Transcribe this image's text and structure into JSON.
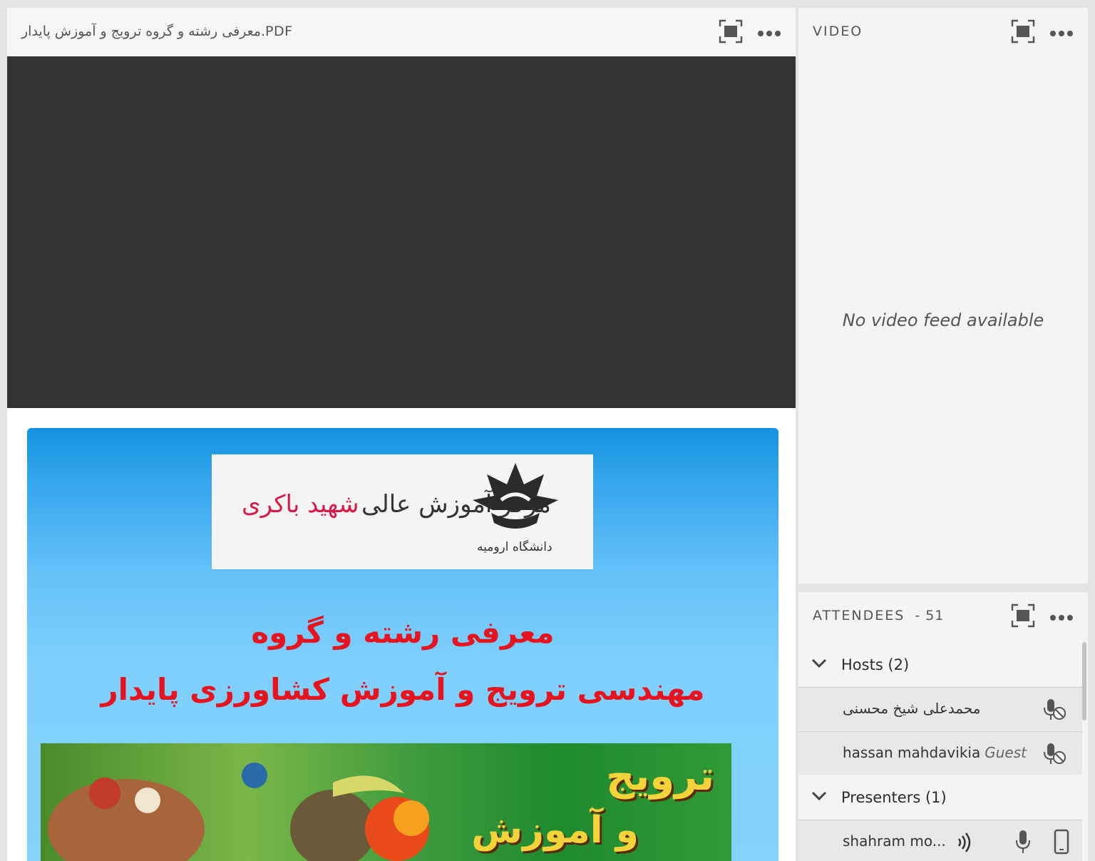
{
  "share_pod": {
    "title": "معرفی رشته و گروه ترویج و آموزش پایدار.PDF",
    "fullscreen_icon": "fullscreen-icon",
    "more_icon": "more-options-icon",
    "slide": {
      "logo_org_line_1": "مرکز آموزش عالی",
      "logo_org_line_2": "شهید باکری",
      "logo_sub": "دانشگاه ارومیه",
      "heading_line_1": "معرفی رشته و گروه",
      "heading_line_2": "مهندسی ترویج و آموزش کشاورزی پایدار",
      "banner_line_1": "ترویج",
      "banner_line_2": "و آموزش"
    },
    "colors": {
      "stage": "#323232",
      "slide_text": "#e8131f"
    }
  },
  "video_pod": {
    "label": "VIDEO",
    "empty_message": "No video feed available"
  },
  "attendees_pod": {
    "label": "ATTENDEES",
    "count": "- 51",
    "groups": [
      {
        "label": "Hosts (2)",
        "members": [
          {
            "name": "محمدعلی شیخ محسنی",
            "role": ""
          },
          {
            "name": "hassan mahdavikia",
            "role": "Guest"
          }
        ]
      },
      {
        "label": "Presenters (1)",
        "members": [
          {
            "name": "shahram mo...",
            "role": ""
          }
        ]
      }
    ]
  }
}
